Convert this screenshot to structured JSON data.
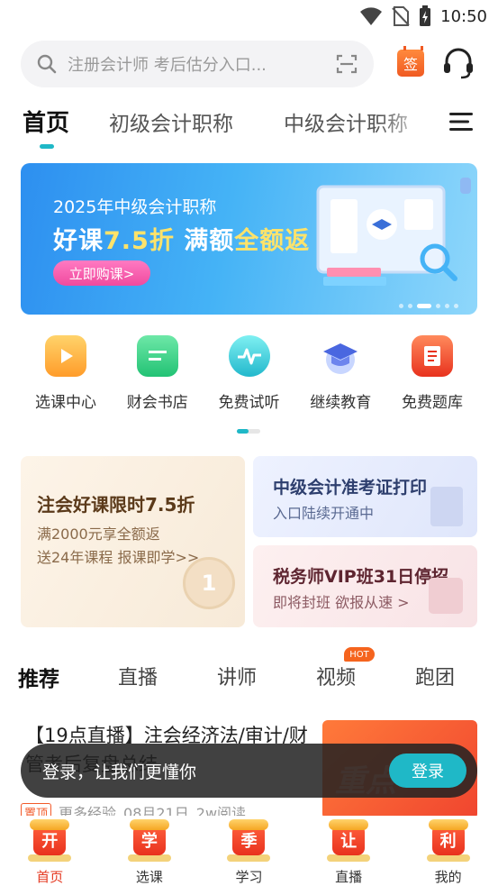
{
  "status": {
    "time": "10:50"
  },
  "search": {
    "placeholder": "注册会计师 考后估分入口..."
  },
  "header": {
    "sign_label": "签"
  },
  "top_tabs": [
    {
      "label": "首页",
      "active": true
    },
    {
      "label": "初级会计职称"
    },
    {
      "label": "中级会计职称"
    }
  ],
  "banner": {
    "subtitle": "2025年中级会计职称",
    "title_a": "好课",
    "title_b": "7.5折",
    "title_c": " 满额",
    "title_d": "全额返",
    "button": "立即购课>"
  },
  "quick_links": [
    {
      "label": "选课中心",
      "icon": "video-course-icon",
      "color": "#ffb23a"
    },
    {
      "label": "财会书店",
      "icon": "book-store-icon",
      "color": "#3fd38a"
    },
    {
      "label": "免费试听",
      "icon": "audio-wave-icon",
      "color": "#35c9d6"
    },
    {
      "label": "继续教育",
      "icon": "graduation-cap-icon",
      "color": "#5a7cf0"
    },
    {
      "label": "免费题库",
      "icon": "question-bank-icon",
      "color": "#f25a3a"
    }
  ],
  "promos": {
    "main": {
      "title": "注会好课限时7.5折",
      "line1": "满2000元享全额返",
      "line2": "送24年课程 报课即学>>",
      "medal": "1"
    },
    "card_a": {
      "title": "中级会计准考证打印",
      "subtitle": "入口陆续开通中"
    },
    "card_b": {
      "title": "税务师VIP班31日停招",
      "subtitle": "即将封班 欲报从速 >"
    }
  },
  "rec_tabs": [
    {
      "label": "推荐",
      "active": true
    },
    {
      "label": "直播"
    },
    {
      "label": "讲师"
    },
    {
      "label": "视频",
      "badge": "HOT"
    },
    {
      "label": "跑团"
    }
  ],
  "article": {
    "title": "【19点直播】注会经济法/审计/财管考后复盘总结",
    "pin": "置顶",
    "author": "更多经验",
    "date": "08月21日",
    "reads": "2w阅读",
    "thumb_text": "重点"
  },
  "login_toast": {
    "text": "登录，让我们更懂你",
    "button": "登录"
  },
  "bottom_nav": [
    {
      "label": "首页",
      "glyph": "开",
      "active": true
    },
    {
      "label": "选课",
      "glyph": "学"
    },
    {
      "label": "学习",
      "glyph": "季"
    },
    {
      "label": "直播",
      "glyph": "让"
    },
    {
      "label": "我的",
      "glyph": "利"
    }
  ]
}
